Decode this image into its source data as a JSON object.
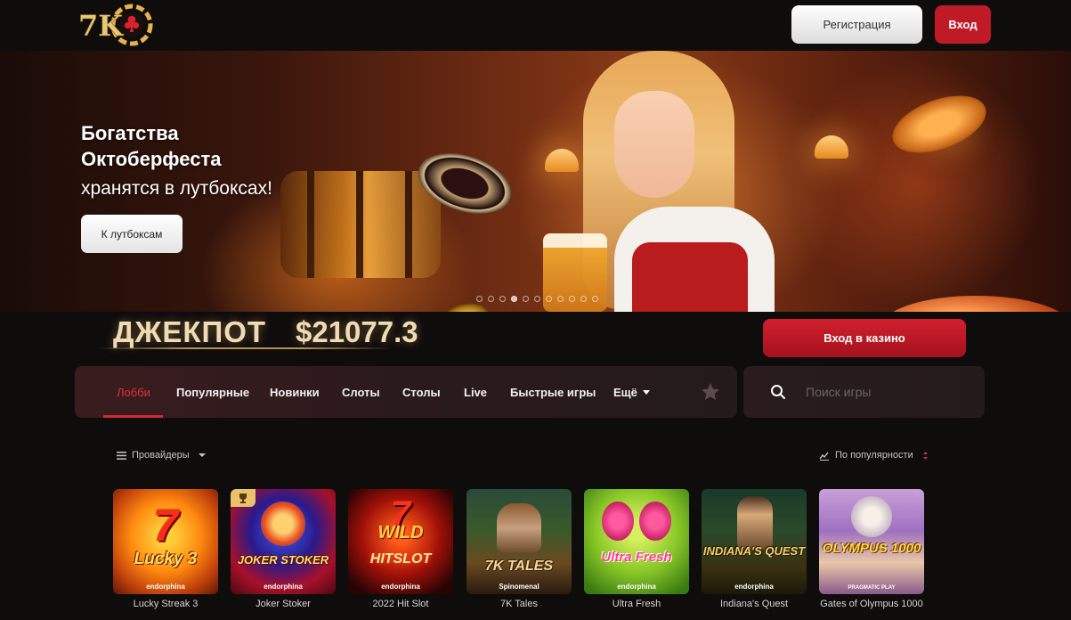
{
  "header": {
    "logo_text": "7K",
    "register_label": "Регистрация",
    "login_label": "Вход"
  },
  "banner": {
    "title": "Богатства Октоберфеста",
    "subtitle": "хранятся в лутбоксах!",
    "button_label": "К лутбоксам",
    "slide_count": 11,
    "active_slide": 3
  },
  "jackpot": {
    "label": "ДЖЕКПОТ",
    "value": "$21077.3",
    "enter_casino_label": "Вход в казино"
  },
  "nav": {
    "tabs": [
      {
        "label": "Лобби",
        "active": true
      },
      {
        "label": "Популярные"
      },
      {
        "label": "Новинки"
      },
      {
        "label": "Слоты"
      },
      {
        "label": "Столы"
      },
      {
        "label": "Live"
      },
      {
        "label": "Быстрые игры"
      },
      {
        "label": "Ещё"
      }
    ]
  },
  "search": {
    "placeholder": "Поиск игры"
  },
  "filters": {
    "providers_label": "Провайдеры",
    "sort_label": "По популярности"
  },
  "colors": {
    "accent": "#c01a27",
    "background": "#0f0c0c",
    "jackpot_text": "#f0dcb4"
  },
  "games": [
    {
      "name": "Lucky Streak 3",
      "art": "Lucky 3",
      "provider": "endorphina"
    },
    {
      "name": "Joker Stoker",
      "art": "JOKER STOKER",
      "provider": "endorphina"
    },
    {
      "name": "2022 Hit Slot",
      "art": "HITSLOT",
      "provider": "endorphina"
    },
    {
      "name": "7K Tales",
      "art": "7K TALES",
      "provider": "Spinomenal"
    },
    {
      "name": "Ultra Fresh",
      "art": "Ultra Fresh",
      "provider": "endorphina"
    },
    {
      "name": "Indiana's Quest",
      "art": "INDIANA'S QUEST",
      "provider": "endorphina"
    },
    {
      "name": "Gates of Olympus 1000",
      "art": "OLYMPUS 1000",
      "provider": "PRAGMATIC PLAY"
    }
  ]
}
